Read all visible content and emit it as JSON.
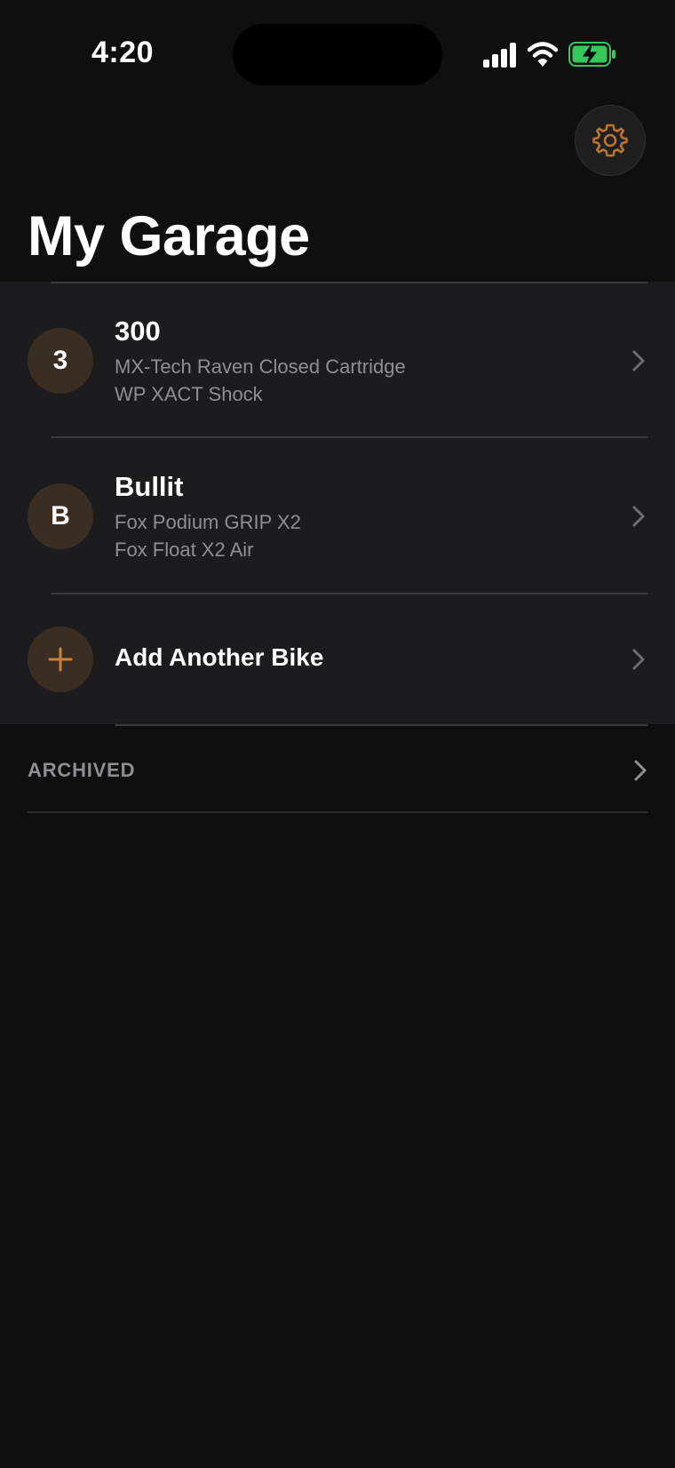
{
  "status_bar": {
    "time": "4:20"
  },
  "colors": {
    "accent": "#c9823f",
    "background": "#0f0f0f",
    "card": "#1c1c1e",
    "battery_green": "#34c759"
  },
  "header": {
    "title": "My Garage",
    "settings_icon": "gear-icon"
  },
  "bikes": [
    {
      "initial": "3",
      "name": "300",
      "fork": "MX-Tech Raven Closed Cartridge",
      "shock": "WP XACT Shock"
    },
    {
      "initial": "B",
      "name": "Bullit",
      "fork": "Fox Podium GRIP X2",
      "shock": "Fox Float X2 Air"
    }
  ],
  "add_bike": {
    "label": "Add Another Bike",
    "icon": "plus-icon"
  },
  "archived": {
    "label": "ARCHIVED"
  }
}
